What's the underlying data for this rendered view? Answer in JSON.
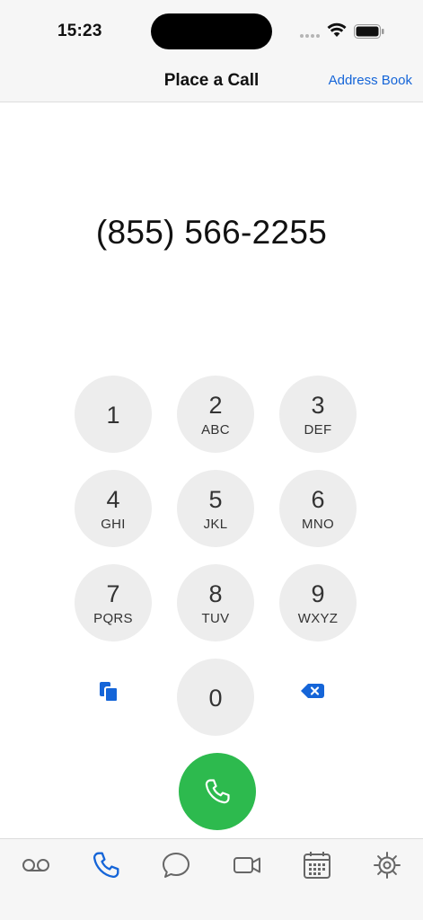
{
  "status_bar": {
    "time": "15:23"
  },
  "nav": {
    "title": "Place a Call",
    "address_book_label": "Address Book"
  },
  "dialer": {
    "number": "(855) 566-2255",
    "keys": [
      {
        "digit": "1",
        "letters": ""
      },
      {
        "digit": "2",
        "letters": "ABC"
      },
      {
        "digit": "3",
        "letters": "DEF"
      },
      {
        "digit": "4",
        "letters": "GHI"
      },
      {
        "digit": "5",
        "letters": "JKL"
      },
      {
        "digit": "6",
        "letters": "MNO"
      },
      {
        "digit": "7",
        "letters": "PQRS"
      },
      {
        "digit": "8",
        "letters": "TUV"
      },
      {
        "digit": "9",
        "letters": "WXYZ"
      },
      {
        "digit": "0",
        "letters": ""
      }
    ]
  },
  "icons": {
    "paste": "paste-icon",
    "backspace": "backspace-icon",
    "call": "phone-icon"
  },
  "tabs": [
    {
      "icon": "voicemail-icon",
      "active": false
    },
    {
      "icon": "phone-icon",
      "active": true
    },
    {
      "icon": "chat-icon",
      "active": false
    },
    {
      "icon": "video-icon",
      "active": false
    },
    {
      "icon": "calendar-icon",
      "active": false
    },
    {
      "icon": "settings-icon",
      "active": false
    }
  ],
  "colors": {
    "accent": "#1565d8",
    "call_green": "#2dba4e",
    "key_background": "#ededed",
    "inactive_icon": "#666666"
  }
}
